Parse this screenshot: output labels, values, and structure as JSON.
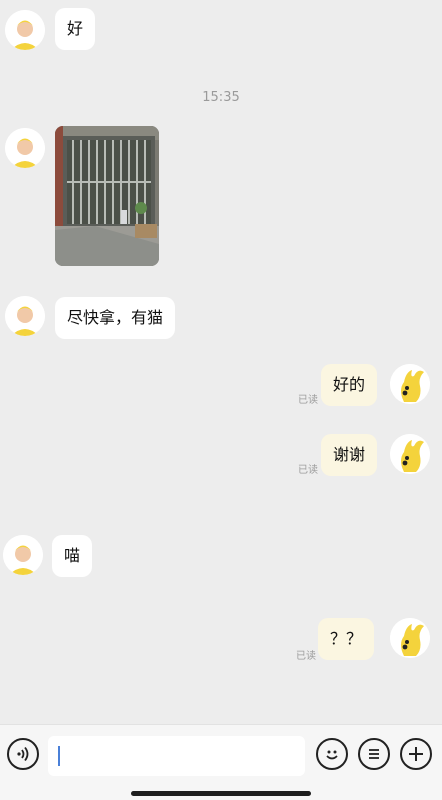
{
  "chat": {
    "timestamp": "15:35",
    "messages": [
      {
        "side": "left",
        "type": "text",
        "text": "好"
      },
      {
        "side": "left",
        "type": "image",
        "description": "photo"
      },
      {
        "side": "left",
        "type": "text",
        "text": "尽快拿，有猫"
      },
      {
        "side": "right",
        "type": "text",
        "text": "好的",
        "status": "已读"
      },
      {
        "side": "right",
        "type": "text",
        "text": "谢谢",
        "status": "已读"
      },
      {
        "side": "left",
        "type": "text",
        "text": "喵"
      },
      {
        "side": "right",
        "type": "text",
        "text": "？？",
        "status": "已读"
      }
    ]
  },
  "input_bar": {
    "icons": [
      "voice-icon",
      "emoji-icon",
      "menu-icon",
      "plus-icon"
    ],
    "value": ""
  },
  "colors": {
    "background": "#ededed",
    "bubble_left": "#ffffff",
    "bubble_right": "#fbf6e1",
    "avatar_yellow": "#f4d33c"
  }
}
